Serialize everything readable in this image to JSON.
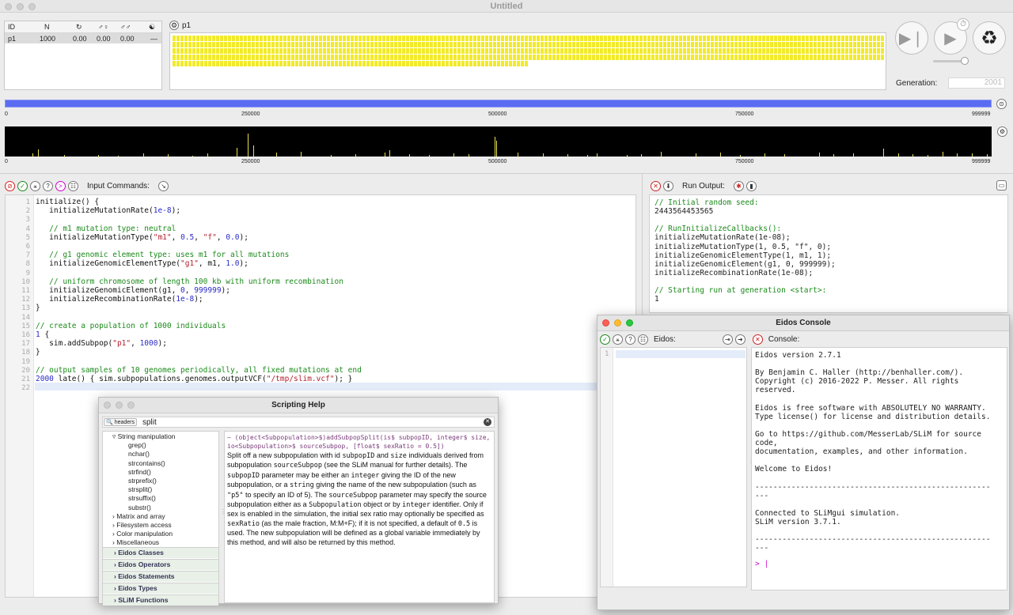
{
  "window": {
    "title": "Untitled"
  },
  "subpop_table": {
    "headers": [
      "ID",
      "N",
      "↻",
      "♂♀",
      "♂♂",
      "☯"
    ],
    "rows": [
      {
        "id": "p1",
        "n": "1000",
        "c1": "0.00",
        "c2": "0.00",
        "c3": "0.00",
        "c4": "—"
      }
    ]
  },
  "population": {
    "label": "p1",
    "fill_fraction": 0.643,
    "color": "#f2ea2a"
  },
  "playback": {
    "generation_label": "Generation:",
    "generation_value": "2001"
  },
  "chromosome": {
    "ticks": [
      "0",
      "250000",
      "500000",
      "750000",
      "999999"
    ],
    "bar_color": "#5b6cf2",
    "mutation_color": "#e9e150"
  },
  "input": {
    "label": "Input Commands:"
  },
  "script_lines": [
    [
      {
        "t": "initialize() {"
      }
    ],
    [
      {
        "t": "   initializeMutationRate("
      },
      {
        "t": "1e-8",
        "c": "nm"
      },
      {
        "t": ");"
      }
    ],
    [],
    [
      {
        "t": "   // m1 mutation type: neutral",
        "c": "cm"
      }
    ],
    [
      {
        "t": "   initializeMutationType("
      },
      {
        "t": "\"m1\"",
        "c": "st"
      },
      {
        "t": ", "
      },
      {
        "t": "0.5",
        "c": "nm"
      },
      {
        "t": ", "
      },
      {
        "t": "\"f\"",
        "c": "st"
      },
      {
        "t": ", "
      },
      {
        "t": "0.0",
        "c": "nm"
      },
      {
        "t": ");"
      }
    ],
    [],
    [
      {
        "t": "   // g1 genomic element type: uses m1 for all mutations",
        "c": "cm"
      }
    ],
    [
      {
        "t": "   initializeGenomicElementType("
      },
      {
        "t": "\"g1\"",
        "c": "st"
      },
      {
        "t": ", m1, "
      },
      {
        "t": "1.0",
        "c": "nm"
      },
      {
        "t": ");"
      }
    ],
    [],
    [
      {
        "t": "   // uniform chromosome of length 100 kb with uniform recombination",
        "c": "cm"
      }
    ],
    [
      {
        "t": "   initializeGenomicElement(g1, "
      },
      {
        "t": "0",
        "c": "nm"
      },
      {
        "t": ", "
      },
      {
        "t": "999999",
        "c": "nm"
      },
      {
        "t": ");"
      }
    ],
    [
      {
        "t": "   initializeRecombinationRate("
      },
      {
        "t": "1e-8",
        "c": "nm"
      },
      {
        "t": ");"
      }
    ],
    [
      {
        "t": "}"
      }
    ],
    [],
    [
      {
        "t": "// create a population of 1000 individuals",
        "c": "cm"
      }
    ],
    [
      {
        "t": "1",
        "c": "nm"
      },
      {
        "t": " {"
      }
    ],
    [
      {
        "t": "   sim.addSubpop("
      },
      {
        "t": "\"p1\"",
        "c": "st"
      },
      {
        "t": ", "
      },
      {
        "t": "1000",
        "c": "nm"
      },
      {
        "t": ");"
      }
    ],
    [
      {
        "t": "}"
      }
    ],
    [],
    [
      {
        "t": "// output samples of 10 genomes periodically, all fixed mutations at end",
        "c": "cm"
      }
    ],
    [
      {
        "t": "2000",
        "c": "nm"
      },
      {
        "t": " late() { sim.subpopulations.genomes.outputVCF("
      },
      {
        "t": "\"/tmp/slim.vcf\"",
        "c": "st"
      },
      {
        "t": "); }"
      }
    ],
    []
  ],
  "output": {
    "label": "Run Output:",
    "lines": [
      {
        "t": "// Initial random seed:",
        "c": "cm"
      },
      {
        "t": "2443564453565"
      },
      {
        "t": ""
      },
      {
        "t": "// RunInitializeCallbacks():",
        "c": "cm"
      },
      {
        "t": "initializeMutationRate(1e-08);"
      },
      {
        "t": "initializeMutationType(1, 0.5, \"f\", 0);"
      },
      {
        "t": "initializeGenomicElementType(1, m1, 1);"
      },
      {
        "t": "initializeGenomicElement(g1, 0, 999999);"
      },
      {
        "t": "initializeRecombinationRate(1e-08);"
      },
      {
        "t": ""
      },
      {
        "t": "// Starting run at generation <start>:",
        "c": "cm"
      },
      {
        "t": "1"
      }
    ]
  },
  "eidos": {
    "title": "Eidos Console",
    "input_label": "Eidos:",
    "console_label": "Console:",
    "line_number": "1",
    "lines": [
      "Eidos version 2.7.1",
      "",
      "By Benjamin C. Haller (http://benhaller.com/).",
      "Copyright (c) 2016-2022 P. Messer. All rights",
      "reserved.",
      "",
      "Eidos is free software with ABSOLUTELY NO WARRANTY.",
      "Type license() for license and distribution details.",
      "",
      "Go to https://github.com/MesserLab/SLiM for source",
      "code,",
      "documentation, examples, and other information.",
      "",
      "Welcome to Eidos!",
      "",
      "----------------------------------------------------",
      "---",
      "",
      "Connected to SLiMgui simulation.",
      "SLiM version 3.7.1.",
      "",
      "----------------------------------------------------",
      "---"
    ],
    "prompt": ">"
  },
  "help": {
    "title": "Scripting Help",
    "search_scope": "headers",
    "search_value": "split",
    "outline": [
      {
        "t": "String manipulation",
        "lvl": 1,
        "open": true
      },
      {
        "t": "grep()",
        "lvl": 2
      },
      {
        "t": "nchar()",
        "lvl": 2
      },
      {
        "t": "strcontains()",
        "lvl": 2
      },
      {
        "t": "strfind()",
        "lvl": 2
      },
      {
        "t": "strprefix()",
        "lvl": 2
      },
      {
        "t": "strsplit()",
        "lvl": 2
      },
      {
        "t": "strsuffix()",
        "lvl": 2
      },
      {
        "t": "substr()",
        "lvl": 2
      },
      {
        "t": "Matrix and array",
        "lvl": 1
      },
      {
        "t": "Filesystem access",
        "lvl": 1
      },
      {
        "t": "Color manipulation",
        "lvl": 1
      },
      {
        "t": "Miscellaneous",
        "lvl": 1
      }
    ],
    "categories": [
      "Eidos Classes",
      "Eidos Operators",
      "Eidos Statements",
      "Eidos Types",
      "SLiM Functions"
    ],
    "signature": "– (object<Subpopulation>$)addSubpopSplit(is$ subpopID, integer$ size, io<Subpopulation>$ sourceSubpop, [float$ sexRatio = 0.5])",
    "body": [
      {
        "t": "Split off a new subpopulation with id "
      },
      {
        "t": "subpopID",
        "m": 1
      },
      {
        "t": " and "
      },
      {
        "t": "size",
        "m": 1
      },
      {
        "t": " individuals derived from subpopulation "
      },
      {
        "t": "sourceSubpop",
        "m": 1
      },
      {
        "t": " (see the SLiM manual for further details). The "
      },
      {
        "t": "subpopID",
        "m": 1
      },
      {
        "t": " parameter may be either an "
      },
      {
        "t": "integer",
        "m": 1
      },
      {
        "t": " giving the ID of the new subpopulation, or a "
      },
      {
        "t": "string",
        "m": 1
      },
      {
        "t": " giving the name of the new subpopulation (such as "
      },
      {
        "t": "\"p5\"",
        "m": 1
      },
      {
        "t": " to specify an ID of 5).  The "
      },
      {
        "t": "sourceSubpop",
        "m": 1
      },
      {
        "t": " parameter may specify the source subpopulation either as a "
      },
      {
        "t": "Subpopulation",
        "m": 1
      },
      {
        "t": " object or by "
      },
      {
        "t": "integer",
        "m": 1
      },
      {
        "t": " identifier.  Only if sex is enabled in the simulation, the initial sex ratio may optionally be specified as "
      },
      {
        "t": "sexRatio",
        "m": 1
      },
      {
        "t": " (as the male fraction, M:M+F); if it is not specified, a default of "
      },
      {
        "t": "0.5",
        "m": 1
      },
      {
        "t": " is used.  The new subpopulation will be defined as a global variable immediately by this method, and will also be returned by this method."
      }
    ]
  }
}
